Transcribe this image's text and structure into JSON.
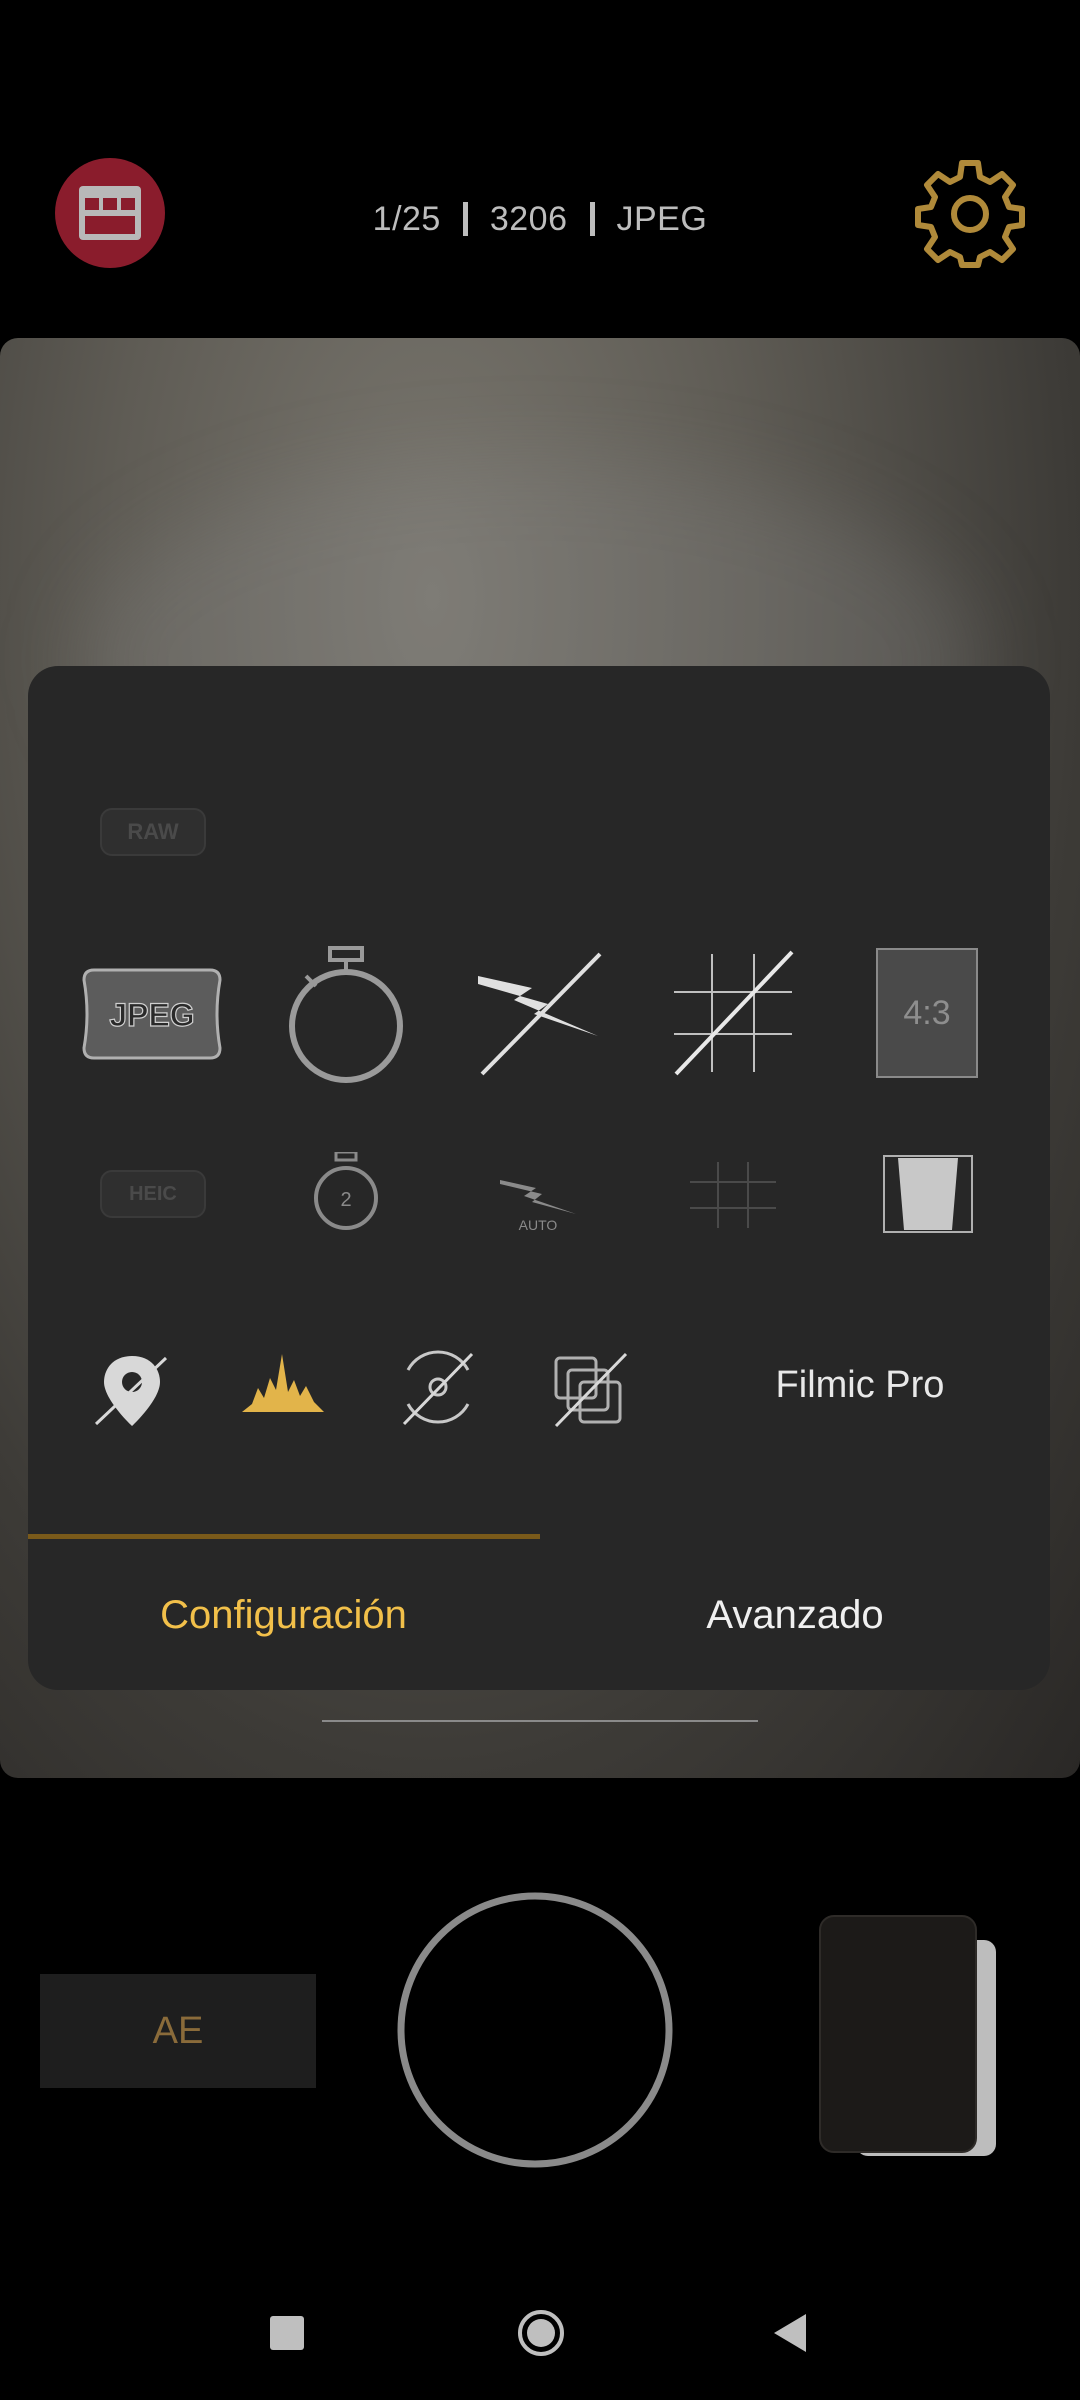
{
  "status": {
    "shutter": "1/25",
    "iso": "3206",
    "format": "JPEG"
  },
  "panel": {
    "raw_label": "RAW",
    "jpeg_label": "JPEG",
    "heic_label": "HEIC",
    "timer_secondary_label": "2",
    "flash_auto_label": "AUTO",
    "ratio_label": "4:3",
    "preset_label": "Filmic Pro",
    "tabs": [
      {
        "label": "Configuración",
        "active": true
      },
      {
        "label": "Avanzado",
        "active": false
      }
    ]
  },
  "bottom": {
    "ae_label": "AE"
  },
  "icons": {
    "logo": "filmic-logo-icon",
    "settings": "gear-icon",
    "timer": "timer-icon",
    "flash_off": "flash-off-icon",
    "grid_off": "grid-off-icon",
    "geotag_off": "location-off-icon",
    "histogram": "histogram-icon",
    "stabilization_off": "stabilization-off-icon",
    "multi_exposure_off": "layers-off-icon"
  },
  "colors": {
    "accent": "#f2c04a",
    "gear": "#b08a3a",
    "logo_bg": "#8a1c2c",
    "panel_bg": "#272727"
  }
}
